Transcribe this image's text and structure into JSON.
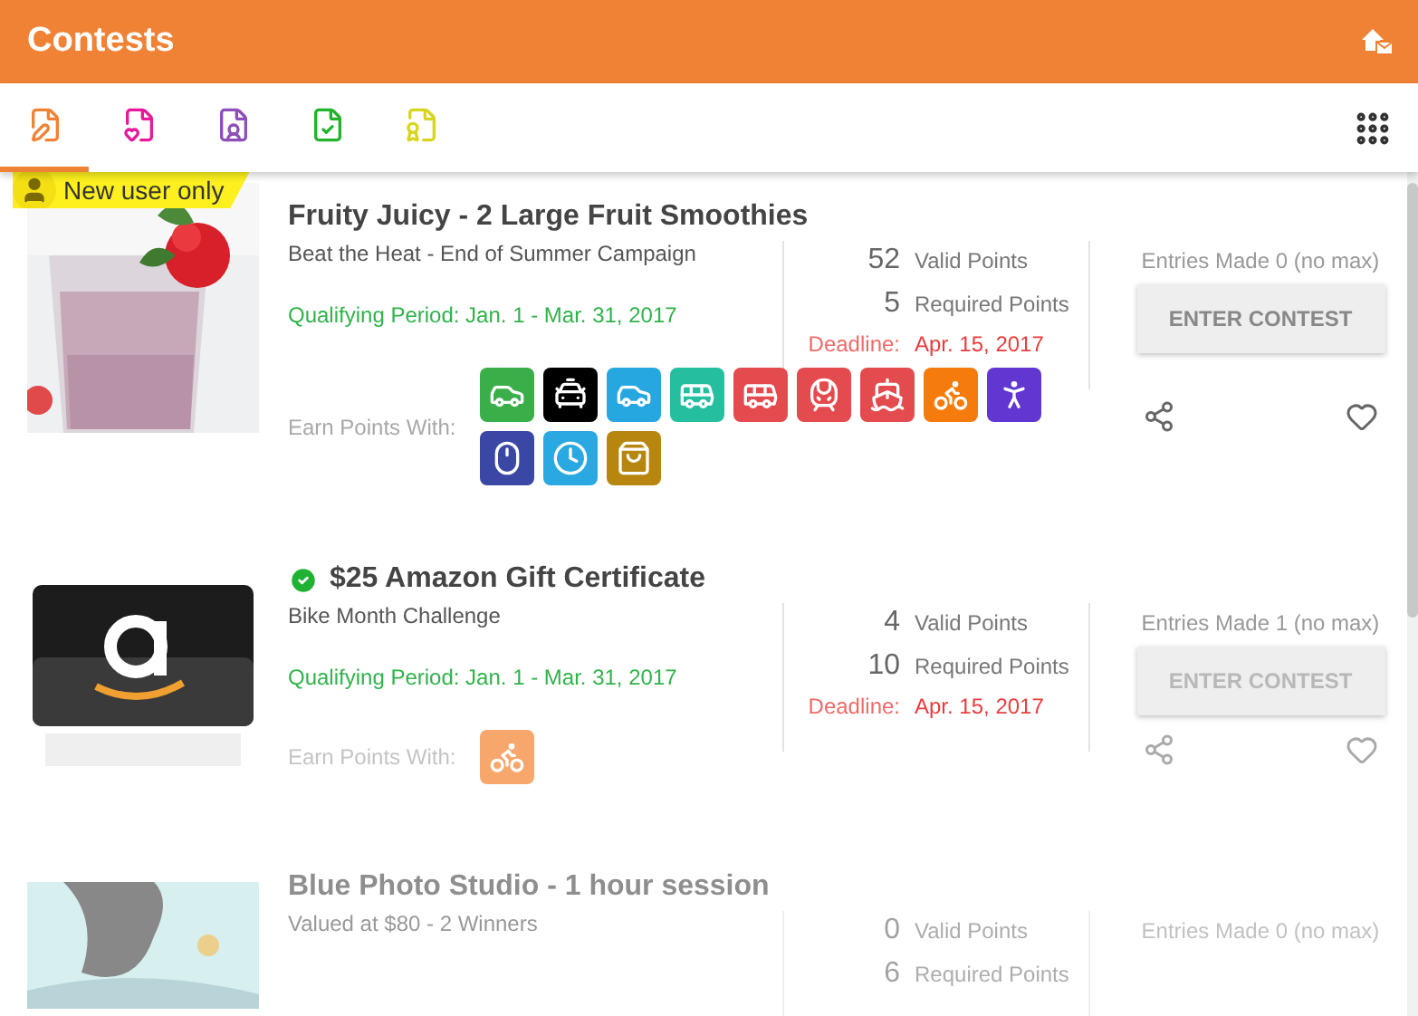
{
  "header": {
    "title": "Contests"
  },
  "tabs": [
    {
      "kind": "pen",
      "color": "#f08236",
      "selected": true
    },
    {
      "kind": "heart",
      "color": "#e8199a",
      "selected": false
    },
    {
      "kind": "user",
      "color": "#8e4fb8",
      "selected": false
    },
    {
      "kind": "check",
      "color": "#22b22c",
      "selected": false
    },
    {
      "kind": "trophy",
      "color": "#d6d61e",
      "selected": false
    }
  ],
  "contests": [
    {
      "badge": "New user only",
      "entered": false,
      "faded": false,
      "title": "Fruity Juicy - 2 Large Fruit Smoothies",
      "subtitle": "Beat the Heat - End of Summer Campaign",
      "period": "Qualifying Period: Jan. 1 - Mar. 31, 2017",
      "earn_label": "Earn Points With:",
      "earn_methods": [
        {
          "kind": "carpool",
          "color": "#3aae49"
        },
        {
          "kind": "taxi",
          "color": "#000000"
        },
        {
          "kind": "ferry-car",
          "color": "#27a7e0"
        },
        {
          "kind": "bus",
          "color": "#25bfa0"
        },
        {
          "kind": "bus",
          "color": "#e44b4f"
        },
        {
          "kind": "train",
          "color": "#e44b4f"
        },
        {
          "kind": "ship",
          "color": "#e44b4f"
        },
        {
          "kind": "bike",
          "color": "#f57b0c"
        },
        {
          "kind": "walk",
          "color": "#6236d0"
        },
        {
          "kind": "mouse",
          "color": "#3b47a5"
        },
        {
          "kind": "clock",
          "color": "#29a8e2"
        },
        {
          "kind": "bag",
          "color": "#b6860f"
        }
      ],
      "valid_points": "52",
      "valid_label": "Valid Points",
      "required_points": "5",
      "required_label": "Required Points",
      "deadline_label": "Deadline:",
      "deadline": "Apr. 15, 2017",
      "entries": "Entries Made 0 (no max)",
      "button": {
        "label": "ENTER CONTEST",
        "disabled": false
      }
    },
    {
      "entered": true,
      "faded": false,
      "title": "$25 Amazon Gift Certificate",
      "subtitle": "Bike Month Challenge",
      "period": "Qualifying Period: Jan. 1 - Mar. 31, 2017",
      "earn_label": "Earn Points With:",
      "earn_methods": [
        {
          "kind": "bike",
          "color": "#f8a76c"
        }
      ],
      "valid_points": "4",
      "valid_label": "Valid Points",
      "required_points": "10",
      "required_label": "Required Points",
      "deadline_label": "Deadline:",
      "deadline": "Apr. 15, 2017",
      "entries": "Entries Made 1 (no max)",
      "button": {
        "label": "ENTER CONTEST",
        "disabled": true
      }
    },
    {
      "entered": false,
      "faded": true,
      "title": "Blue Photo Studio - 1 hour session",
      "subtitle": "Valued at $80 - 2 Winners",
      "valid_points": "0",
      "valid_label": "Valid Points",
      "required_points": "6",
      "required_label": "Required Points",
      "entries": "Entries Made 0 (no max)"
    }
  ]
}
